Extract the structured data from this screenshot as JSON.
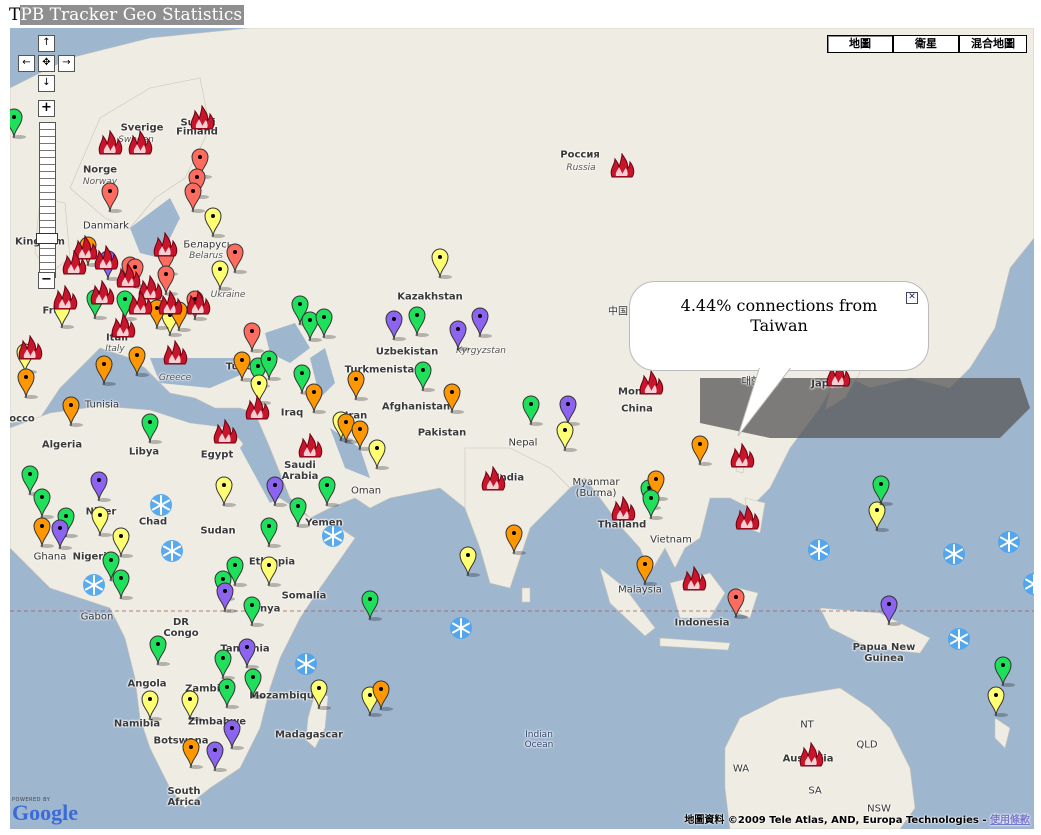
{
  "title": {
    "first_letter": "T",
    "rest": "PB Tracker Geo Statistics"
  },
  "map_types": [
    {
      "label": "地圖",
      "active": true
    },
    {
      "label": "衛星",
      "active": false
    },
    {
      "label": "混合地圖",
      "active": false
    }
  ],
  "nav": {
    "up": "↑",
    "left": "←",
    "center": "✥",
    "right": "→",
    "down": "↓",
    "zoom_in": "+",
    "zoom_out": "−"
  },
  "info_window": {
    "text": "4.44% connections from Taiwan",
    "close": "✕"
  },
  "attribution": {
    "text": "地圖資料 ©2009 Tele Atlas, AND, Europa Technologies -",
    "link": "使用條款"
  },
  "powered_by": {
    "small": "POWERED BY",
    "logo": "Google"
  },
  "colors": {
    "green": "#1fe05a",
    "orange": "#ff9800",
    "yellow": "#ffff73",
    "salmon": "#ff6b5e",
    "purple": "#8c64ef",
    "fire": "#c8152b",
    "snow": "#4aa3ee",
    "water": "#9fb6cf",
    "land": "#efece3"
  },
  "labels": [
    {
      "text": "Россия",
      "cls": "country"
    },
    {
      "text": "Russia",
      "cls": "sub"
    },
    {
      "text": "Sverige",
      "cls": "country"
    },
    {
      "text": "Sweden",
      "cls": "sub"
    },
    {
      "text": "Suomi",
      "cls": "country"
    },
    {
      "text": "Finland",
      "cls": "country"
    },
    {
      "text": "Norge",
      "cls": "country"
    },
    {
      "text": "Norway",
      "cls": "sub"
    },
    {
      "text": "Danmark",
      "cls": ""
    },
    {
      "text": "Беларусь",
      "cls": ""
    },
    {
      "text": "Belarus",
      "cls": "sub"
    },
    {
      "text": "Kingdom",
      "cls": "country"
    },
    {
      "text": "Ukraine",
      "cls": "sub"
    },
    {
      "text": "Fran",
      "cls": "country"
    },
    {
      "text": "Itali",
      "cls": "country"
    },
    {
      "text": "Italy",
      "cls": "sub"
    },
    {
      "text": "Greece",
      "cls": "sub"
    },
    {
      "text": "Türk",
      "cls": "country"
    },
    {
      "text": "Kazakhstan",
      "cls": "country"
    },
    {
      "text": "Uzbekistan",
      "cls": "country"
    },
    {
      "text": "Turkmenistan",
      "cls": "country"
    },
    {
      "text": "Afghanistan",
      "cls": "country"
    },
    {
      "text": "Pakistan",
      "cls": "country"
    },
    {
      "text": "Iran",
      "cls": "country"
    },
    {
      "text": "Iraq",
      "cls": "country"
    },
    {
      "text": "Saudi\nArabia",
      "cls": "country"
    },
    {
      "text": "Oman",
      "cls": ""
    },
    {
      "text": "Egypt",
      "cls": "country"
    },
    {
      "text": "Libya",
      "cls": "country"
    },
    {
      "text": "Algeria",
      "cls": "country"
    },
    {
      "text": "Tunisia",
      "cls": ""
    },
    {
      "text": "occo",
      "cls": "country"
    },
    {
      "text": "Niger",
      "cls": "country"
    },
    {
      "text": "Chad",
      "cls": "country"
    },
    {
      "text": "Sudan",
      "cls": "country"
    },
    {
      "text": "Nigeria",
      "cls": "country"
    },
    {
      "text": "Ghana",
      "cls": ""
    },
    {
      "text": "Ethiopia",
      "cls": "country"
    },
    {
      "text": "Yemen",
      "cls": "country"
    },
    {
      "text": "Somalia",
      "cls": "country"
    },
    {
      "text": "Kenya",
      "cls": "country"
    },
    {
      "text": "DR\nCongo",
      "cls": "country"
    },
    {
      "text": "Gabon",
      "cls": ""
    },
    {
      "text": "Tanzania",
      "cls": "country"
    },
    {
      "text": "Angola",
      "cls": "country"
    },
    {
      "text": "Zambia",
      "cls": "country"
    },
    {
      "text": "Mozambique",
      "cls": "country"
    },
    {
      "text": "Zimbabwe",
      "cls": "country"
    },
    {
      "text": "Namibia",
      "cls": "country"
    },
    {
      "text": "Botswana",
      "cls": "country"
    },
    {
      "text": "Madagascar",
      "cls": "country"
    },
    {
      "text": "South\nAfrica",
      "cls": "country"
    },
    {
      "text": "Nepal",
      "cls": ""
    },
    {
      "text": "India",
      "cls": "country"
    },
    {
      "text": "China",
      "cls": "country"
    },
    {
      "text": "中国",
      "cls": ""
    },
    {
      "text": "Mon",
      "cls": "country"
    },
    {
      "text": "대한민국",
      "cls": ""
    },
    {
      "text": "Japan",
      "cls": "country"
    },
    {
      "text": "Myanmar\n(Burma)",
      "cls": ""
    },
    {
      "text": "Thailand",
      "cls": "country"
    },
    {
      "text": "Vietnam",
      "cls": ""
    },
    {
      "text": "Malaysia",
      "cls": ""
    },
    {
      "text": "Indonesia",
      "cls": "country"
    },
    {
      "text": "Papua New\nGuinea",
      "cls": "country"
    },
    {
      "text": "NT",
      "cls": ""
    },
    {
      "text": "QLD",
      "cls": ""
    },
    {
      "text": "WA",
      "cls": ""
    },
    {
      "text": "SA",
      "cls": ""
    },
    {
      "text": "NSW",
      "cls": ""
    },
    {
      "text": "Australia",
      "cls": "country"
    },
    {
      "text": "Indian\nOcean",
      "cls": "ocean"
    },
    {
      "text": "Kyrgyzstan",
      "cls": "sub"
    }
  ]
}
